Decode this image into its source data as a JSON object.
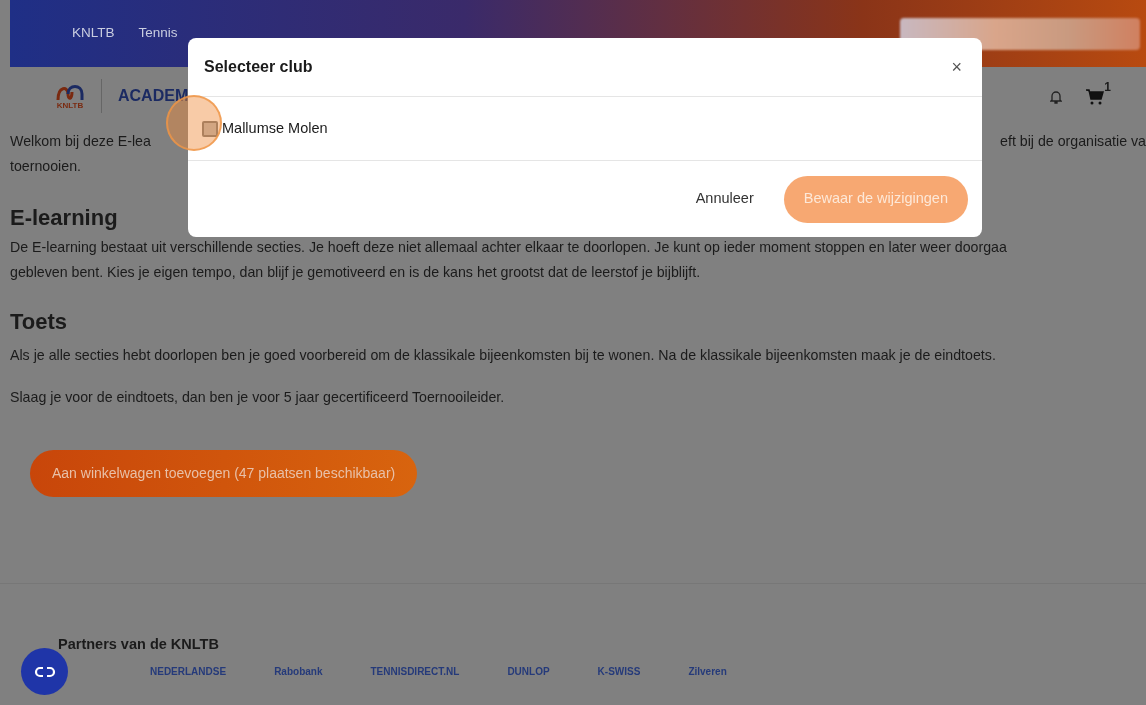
{
  "nav": {
    "items": [
      {
        "label": "KNLTB"
      },
      {
        "label": "Tennis"
      }
    ]
  },
  "header": {
    "logo_text": "KNLTB",
    "brand": "ACADEM",
    "cart_count": "1"
  },
  "intro": {
    "left": "Welkom bij deze E-lea",
    "right": "eft bij de organisatie va",
    "line2": "toernooien."
  },
  "sections": [
    {
      "heading": "E-learning",
      "paragraphs": [
        [
          "De E-learning bestaat uit verschillende secties. Je hoeft deze niet allemaal achter elkaar te doorlopen. Je kunt op ieder moment stoppen en later weer doorgaa",
          "gebleven bent. Kies je eigen tempo, dan blijf je gemotiveerd en is de kans het grootst dat de leerstof je bijblijft."
        ]
      ]
    },
    {
      "heading": "Toets",
      "paragraphs": [
        [
          "Als je alle secties hebt doorlopen ben je goed voorbereid om de klassikale bijeenkomsten bij te wonen. Na de klassikale bijeenkomsten maak je de eindtoets."
        ],
        [
          "Slaag je voor de eindtoets, dan ben je voor 5 jaar gecertificeerd Toernooileider."
        ]
      ]
    }
  ],
  "cta": {
    "label": "Aan winkelwagen toevoegen (47 plaatsen beschikbaar)"
  },
  "partners": {
    "title": "Partners van de KNLTB",
    "logos": [
      "NEDERLANDSE",
      "Rabobank",
      "TENNISDIRECT.NL",
      "DUNLOP",
      "K-SWISS",
      "Zilveren"
    ]
  },
  "modal": {
    "title": "Selecteer club",
    "close": "×",
    "options": [
      {
        "label": "Mallumse Molen",
        "checked": false
      }
    ],
    "cancel": "Annuleer",
    "save": {
      "label": "Bewaar de wijzigingen",
      "disabled": true
    }
  }
}
